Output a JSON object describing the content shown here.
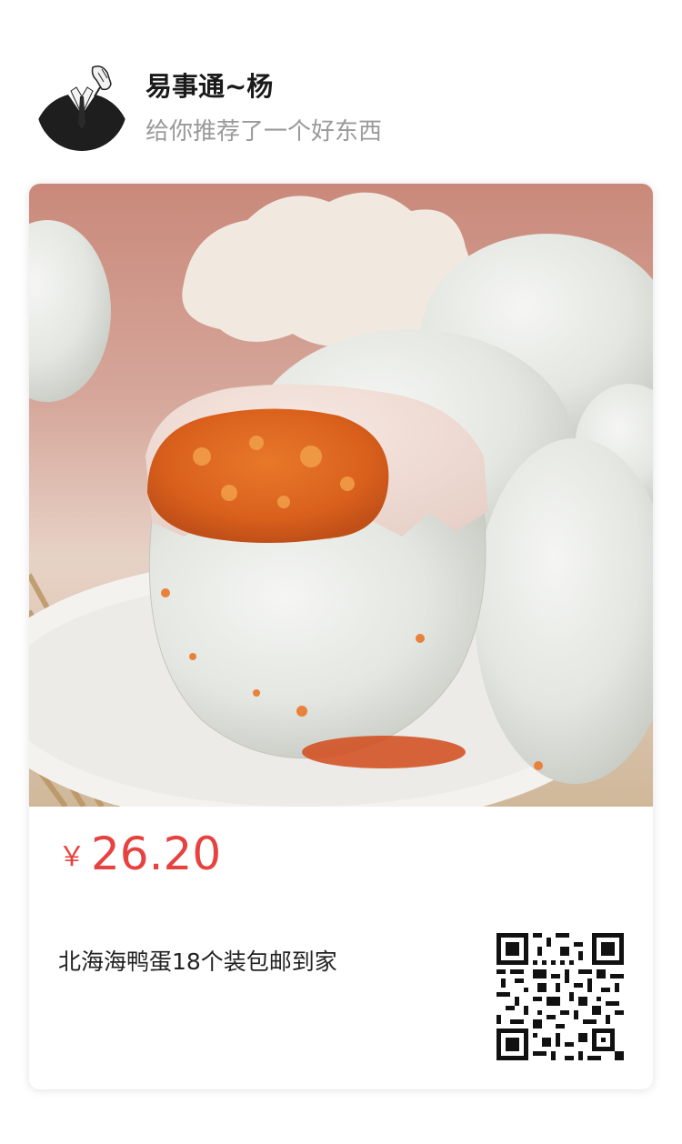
{
  "share_header": {
    "user_name": "易事通~杨",
    "subtitle": "给你推荐了一个好东西",
    "avatar_icon": "suited-man-avatar"
  },
  "product": {
    "image_icon": "salted-duck-egg-photo",
    "currency_symbol": "￥",
    "price": "26.20",
    "title": "北海海鸭蛋18个装包邮到家",
    "qr_icon": "qr-code"
  },
  "colors": {
    "price": "#e64340",
    "subtitle": "#9a9a9a",
    "card_bg": "#ffffff"
  }
}
